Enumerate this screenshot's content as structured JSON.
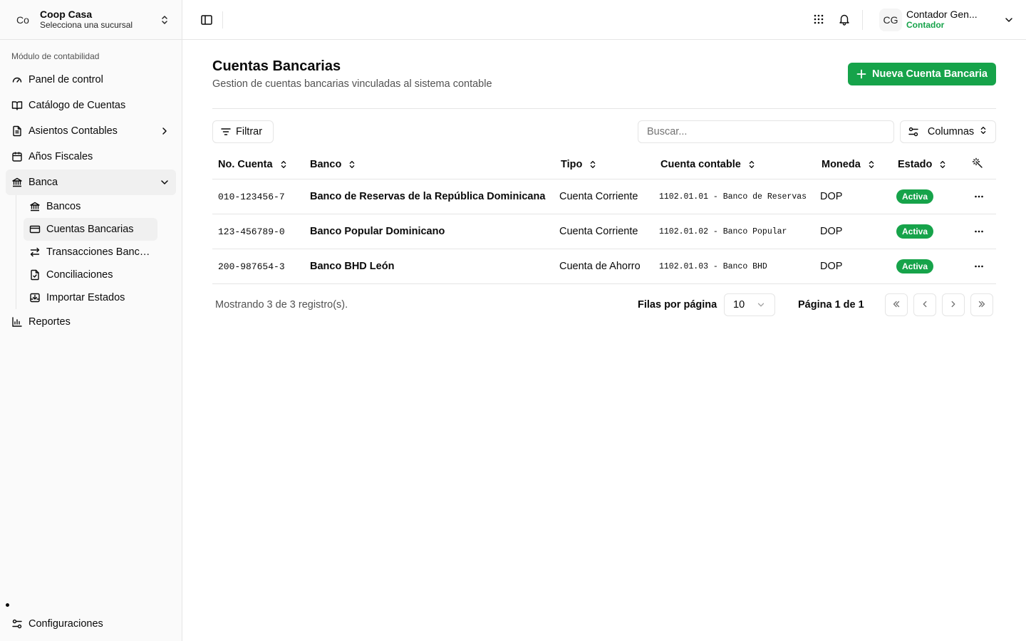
{
  "sidebar": {
    "org_avatar": "Co",
    "org_name": "Coop Casa",
    "org_sub": "Selecciona una sucursal",
    "section_label": "Módulo de contabilidad",
    "items": [
      {
        "label": "Panel de control",
        "icon": "gauge-icon"
      },
      {
        "label": "Catálogo de Cuentas",
        "icon": "book-icon"
      },
      {
        "label": "Asientos Contables",
        "icon": "file-text-icon"
      },
      {
        "label": "Años Fiscales",
        "icon": "calendar-icon"
      },
      {
        "label": "Banca",
        "icon": "bank-icon"
      },
      {
        "label": "Reportes",
        "icon": "bar-chart-icon"
      }
    ],
    "banca_sub": [
      {
        "label": "Bancos",
        "icon": "bank-icon"
      },
      {
        "label": "Cuentas Bancarias",
        "icon": "credit-card-icon"
      },
      {
        "label": "Transacciones Bancarias",
        "icon": "arrows-left-right-icon"
      },
      {
        "label": "Conciliaciones",
        "icon": "file-check-icon"
      },
      {
        "label": "Importar Estados",
        "icon": "import-icon"
      }
    ],
    "settings_label": "Configuraciones"
  },
  "topbar": {
    "user_avatar": "CG",
    "user_name": "Contador Gen...",
    "user_role": "Contador"
  },
  "page": {
    "title": "Cuentas Bancarias",
    "subtitle": "Gestion de cuentas bancarias vinculadas al sistema contable",
    "new_button": "Nueva Cuenta Bancaria",
    "filter_label": "Filtrar",
    "search_placeholder": "Buscar...",
    "columns_label": "Columnas"
  },
  "table": {
    "headers": [
      "No. Cuenta",
      "Banco",
      "Tipo",
      "Cuenta contable",
      "Moneda",
      "Estado"
    ],
    "rows": [
      {
        "numero": "010-123456-7",
        "banco": "Banco de Reservas de la República Dominicana",
        "tipo": "Cuenta Corriente",
        "cuenta_contable": "1102.01.01 - Banco de Reservas",
        "moneda": "DOP",
        "estado": "Activa"
      },
      {
        "numero": "123-456789-0",
        "banco": "Banco Popular Dominicano",
        "tipo": "Cuenta Corriente",
        "cuenta_contable": "1102.01.02 - Banco Popular",
        "moneda": "DOP",
        "estado": "Activa"
      },
      {
        "numero": "200-987654-3",
        "banco": "Banco BHD León",
        "tipo": "Cuenta de Ahorro",
        "cuenta_contable": "1102.01.03 - Banco BHD",
        "moneda": "DOP",
        "estado": "Activa"
      }
    ]
  },
  "pagination": {
    "info": "Mostrando 3 de 3 registro(s).",
    "rows_label": "Filas por página",
    "rows_value": "10",
    "page_label": "Página 1 de 1"
  },
  "colors": {
    "accent": "#16a34a",
    "border": "#e5e5e5",
    "sidebar_bg": "#fafafa"
  }
}
